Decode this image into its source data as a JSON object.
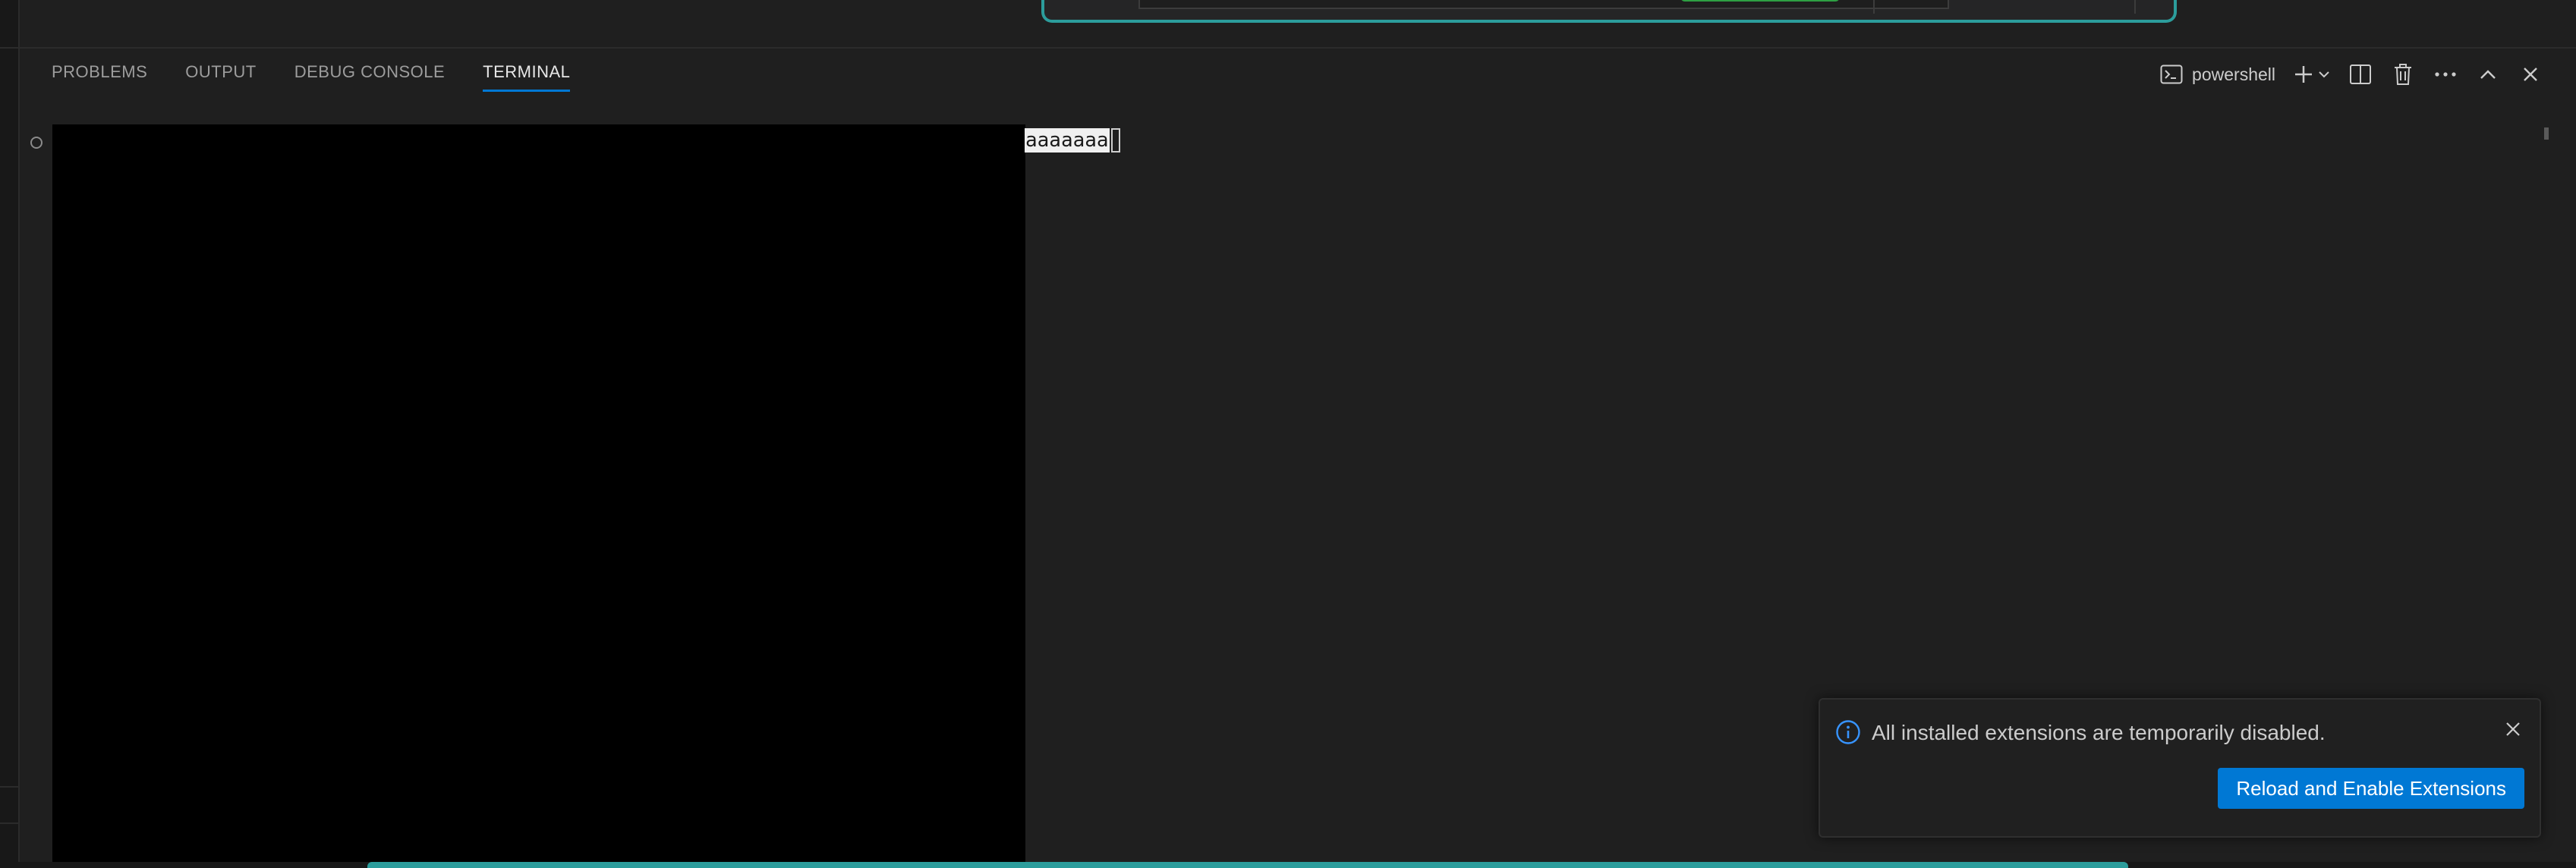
{
  "panel": {
    "tabs": [
      {
        "label": "PROBLEMS"
      },
      {
        "label": "OUTPUT"
      },
      {
        "label": "DEBUG CONSOLE"
      },
      {
        "label": "TERMINAL"
      }
    ],
    "active_tab": "TERMINAL",
    "shell_label": "powershell",
    "icons": [
      "terminal-shell-icon",
      "plus-icon",
      "chevron-down-icon",
      "split-icon",
      "trash-icon",
      "more-icon",
      "maximize-icon",
      "close-icon"
    ]
  },
  "terminal": {
    "typed_text": "aaaaaaa"
  },
  "notification": {
    "message": "All installed extensions are temporarily disabled.",
    "action_label": "Reload and Enable Extensions",
    "icon": "info-icon"
  },
  "colors": {
    "background": "#1f1f1f",
    "accent": "#0078d4",
    "terminal_black": "#000000",
    "dialog_border": "#2c9d9c"
  }
}
